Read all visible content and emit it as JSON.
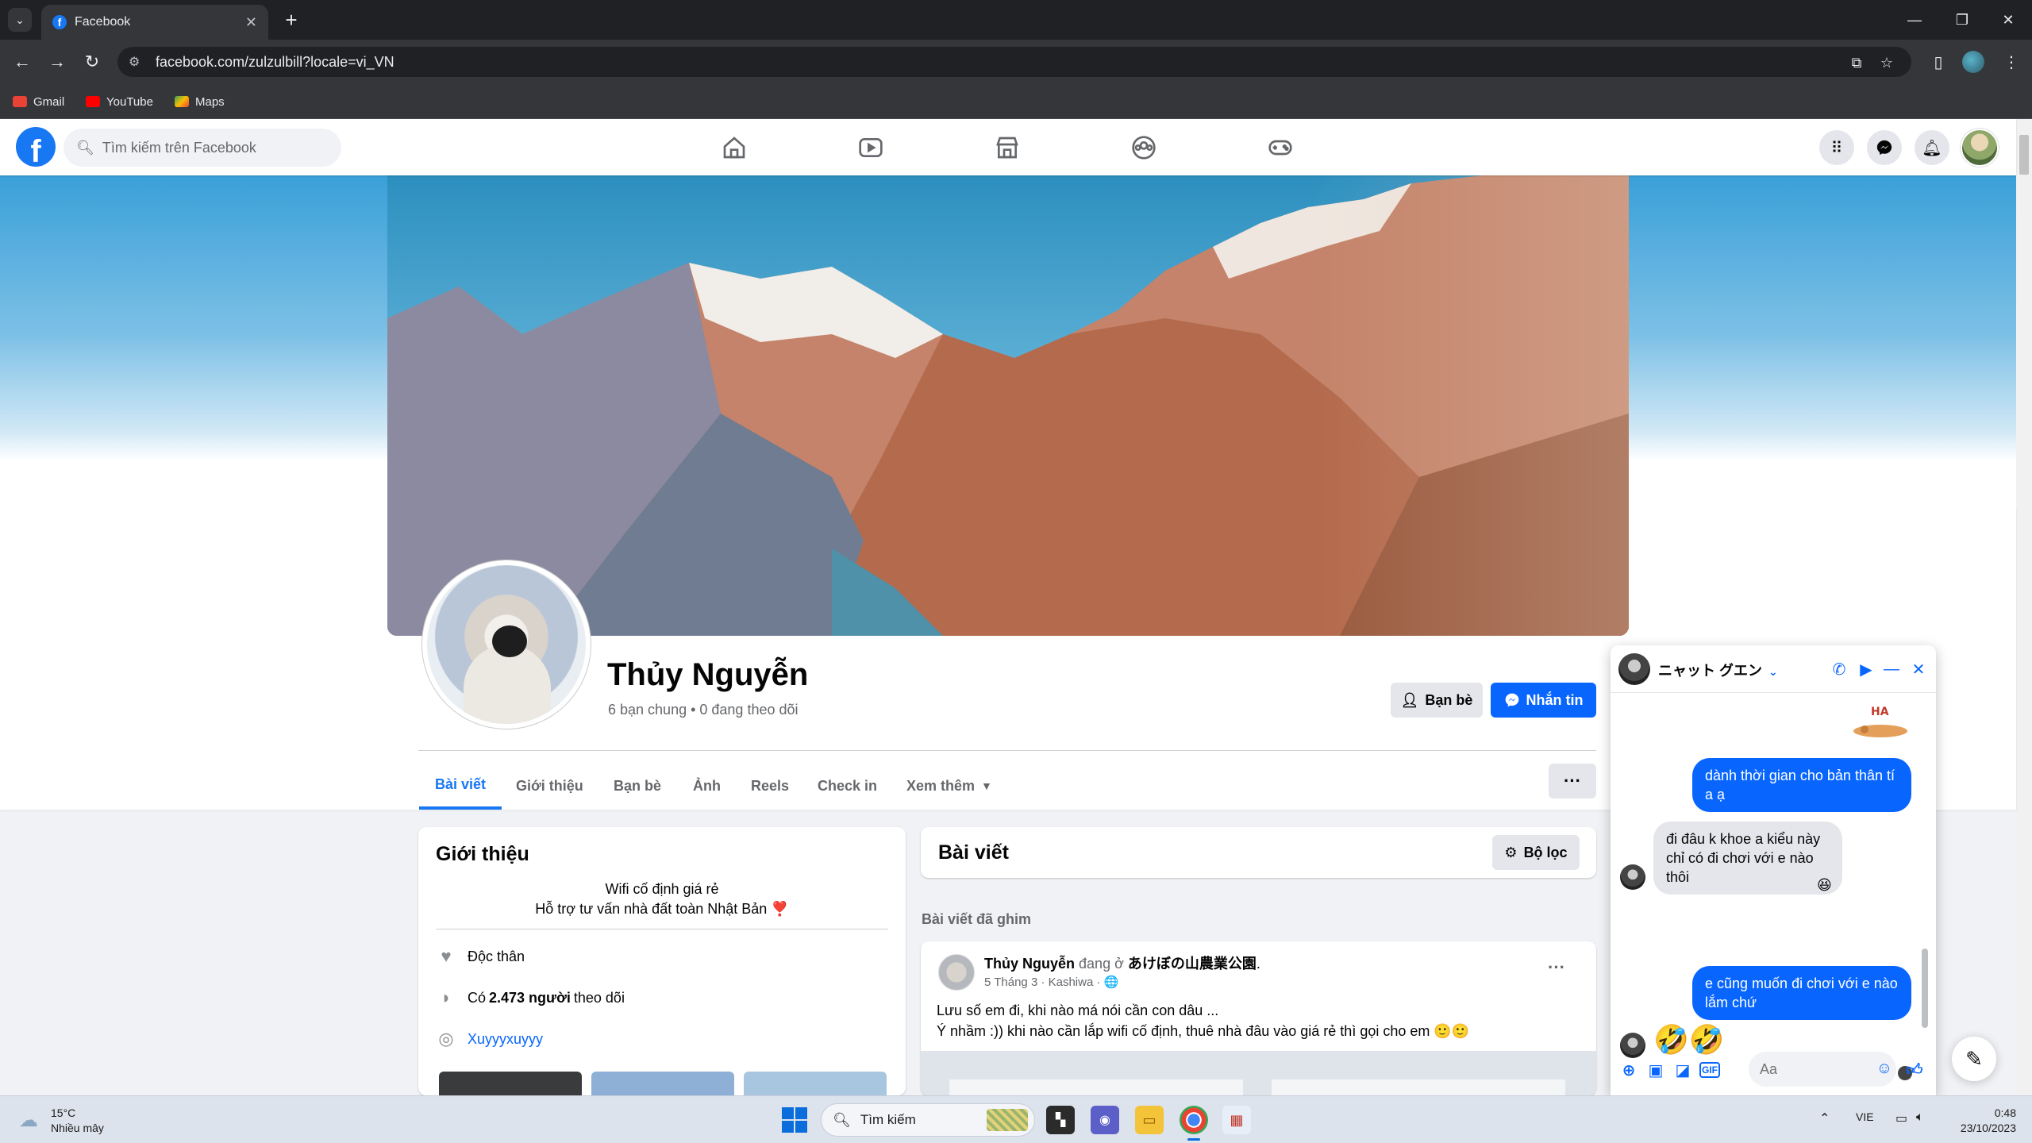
{
  "browser": {
    "tab_title": "Facebook",
    "url": "facebook.com/zulzulbill?locale=vi_VN",
    "bookmarks": [
      {
        "label": "Gmail",
        "color": "#ea4335"
      },
      {
        "label": "YouTube",
        "color": "#ff0000"
      },
      {
        "label": "Maps",
        "color": "#34a853"
      }
    ]
  },
  "header": {
    "search_placeholder": "Tìm kiếm trên Facebook",
    "nav": [
      "home-icon",
      "video-icon",
      "marketplace-icon",
      "groups-icon",
      "gaming-icon"
    ],
    "brand_color": "#1877f2"
  },
  "profile": {
    "name": "Thủy Nguyễn",
    "subtitle": "6 bạn chung • 0 đang theo dõi",
    "friends_button": "Bạn bè",
    "message_button": "Nhắn tin",
    "tabs": [
      "Bài viết",
      "Giới thiệu",
      "Bạn bè",
      "Ảnh",
      "Reels",
      "Check in",
      "Xem thêm"
    ],
    "more_button": "···"
  },
  "intro": {
    "title": "Giới thiệu",
    "bio_line1": "Wifi cố định giá rẻ",
    "bio_line2": "Hỗ trợ tư vấn nhà đất toàn Nhật Bản ❣️",
    "relationship": "Độc thân",
    "followers_prefix": "Có",
    "followers_count": "2.473 người",
    "followers_suffix": "theo dõi",
    "instagram": "Xuyyyxuyyy"
  },
  "posts": {
    "title": "Bài viết",
    "filter_button": "Bộ lọc",
    "pinned_label": "Bài viết đã ghim",
    "post": {
      "author": "Thủy Nguyễn",
      "at": "đang ở",
      "location": "あけぼの山農業公園",
      "meta": "5 Tháng 3 · Kashiwa · 🌐",
      "line1": "Lưu số em đi, khi nào má nói cần con dâu ...",
      "line2": "Ý nhầm :)) khi nào cần lắp wifi cố định, thuê nhà đâu vào giá rẻ thì gọi cho em 🙂🙂"
    }
  },
  "chat": {
    "contact_name": "ニャット グエン",
    "messages": [
      {
        "from": "me",
        "text": "dành thời gian cho bản thân tí a ạ"
      },
      {
        "from": "them",
        "text": "đi đâu k khoe a kiểu này chỉ có đi chơi với e nào thôi",
        "reaction": "😆"
      },
      {
        "from": "me",
        "text": "e cũng muốn đi chơi với e nào lắm chứ"
      },
      {
        "from": "them",
        "text": "🤣🤣"
      }
    ],
    "input_placeholder": "Aa"
  },
  "taskbar": {
    "temperature": "15°C",
    "weather": "Nhiều mây",
    "search_label": "Tìm kiếm",
    "language": "VIE",
    "time": "0:48",
    "date": "23/10/2023"
  }
}
